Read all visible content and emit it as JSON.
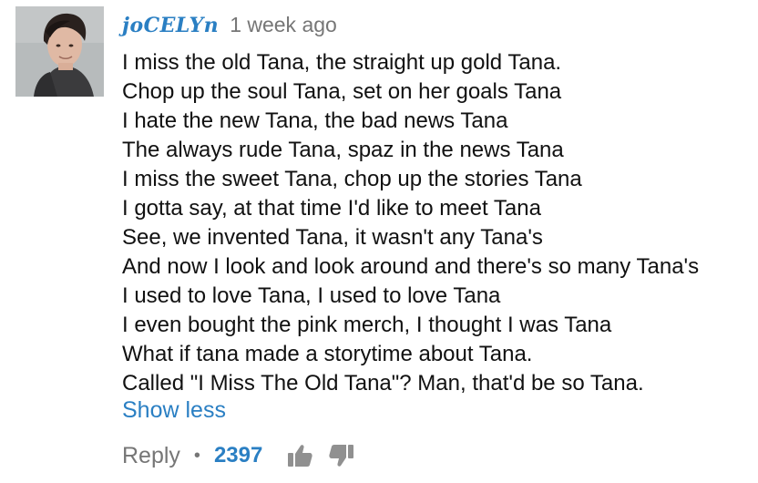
{
  "comment": {
    "author": "joCELYn",
    "timestamp": "1 week ago",
    "lines": [
      "I miss the old Tana, the straight up gold Tana.",
      "Chop up the soul Tana, set on her goals Tana",
      "I hate the new Tana, the bad news Tana",
      "The always rude Tana, spaz in the news Tana",
      "I miss the sweet Tana, chop up the stories Tana",
      "I gotta say, at that time I'd like to meet Tana",
      "See, we invented Tana, it wasn't any Tana's",
      "And now I look and look around and there's so many Tana's",
      "I used to love Tana, I used to love Tana",
      "I even bought the pink merch, I thought I was Tana",
      "What if tana made a storytime about Tana.",
      "Called \"I Miss The Old Tana\"? Man, that'd be so Tana."
    ],
    "show_less_label": "Show less"
  },
  "actions": {
    "reply_label": "Reply",
    "separator": "•",
    "like_count": "2397",
    "like_icon": "thumbs-up-icon",
    "dislike_icon": "thumbs-down-icon"
  },
  "colors": {
    "link_blue": "#2a7fc3",
    "meta_gray": "#767676",
    "body_text": "#111111",
    "icon_gray": "#909090"
  }
}
